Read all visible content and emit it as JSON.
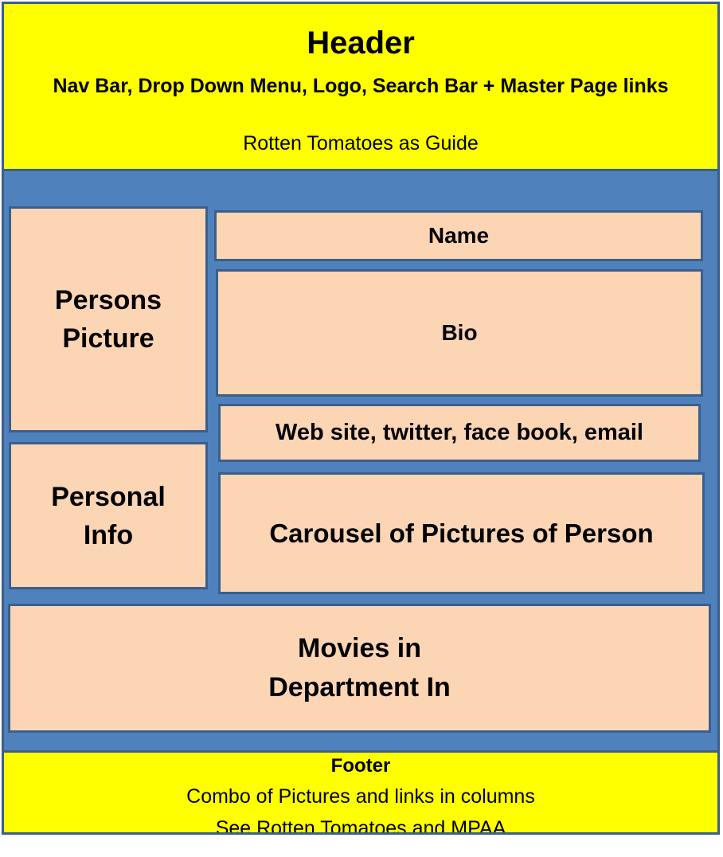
{
  "header": {
    "title": "Header",
    "subtitle": "Nav Bar, Drop Down Menu, Logo, Search Bar + Master Page links",
    "note": "Rotten Tomatoes  as Guide"
  },
  "content": {
    "persons_picture": "Persons Picture",
    "name": "Name",
    "bio": "Bio",
    "social_links": "Web site, twitter, face book, email",
    "personal_info": "Personal Info",
    "carousel": "Carousel of Pictures of Person",
    "movies": "Movies in Department In"
  },
  "footer": {
    "title": "Footer",
    "line1": "Combo of Pictures and links in columns",
    "line2": "See Rotten Tomatoes and MPAA"
  },
  "colors": {
    "header_footer_bg": "#ffff00",
    "body_bg": "#4f81bd",
    "box_fill": "#fcd5b5",
    "box_border": "#3a5f8c"
  }
}
